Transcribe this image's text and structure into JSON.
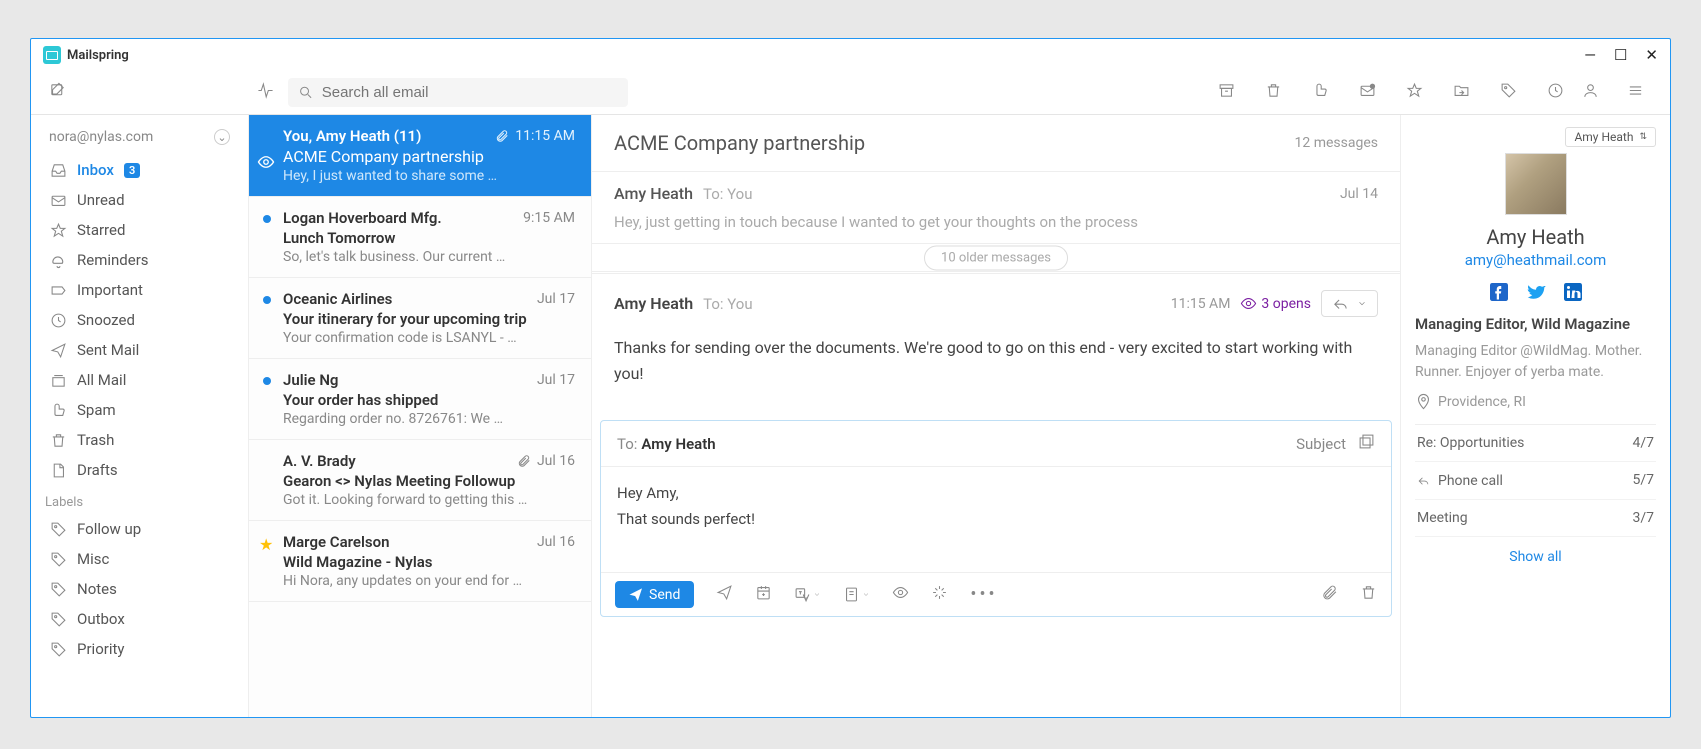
{
  "app": {
    "title": "Mailspring"
  },
  "toolbar": {
    "search_placeholder": "Search all email"
  },
  "account": {
    "email": "nora@nylas.com"
  },
  "sidebar": {
    "folders": [
      {
        "label": "Inbox",
        "badge": "3",
        "active": true,
        "icon": "inbox"
      },
      {
        "label": "Unread",
        "icon": "mail"
      },
      {
        "label": "Starred",
        "icon": "star"
      },
      {
        "label": "Reminders",
        "icon": "bell"
      },
      {
        "label": "Important",
        "icon": "tag"
      },
      {
        "label": "Snoozed",
        "icon": "clock"
      },
      {
        "label": "Sent Mail",
        "icon": "send"
      },
      {
        "label": "All Mail",
        "icon": "stack"
      },
      {
        "label": "Spam",
        "icon": "thumbdown"
      },
      {
        "label": "Trash",
        "icon": "trash"
      },
      {
        "label": "Drafts",
        "icon": "file"
      }
    ],
    "labels_header": "Labels",
    "labels": [
      {
        "label": "Follow up"
      },
      {
        "label": "Misc"
      },
      {
        "label": "Notes"
      },
      {
        "label": "Outbox"
      },
      {
        "label": "Priority"
      }
    ]
  },
  "messages": [
    {
      "from": "You, Amy Heath (11)",
      "time": "11:15 AM",
      "subject": "ACME Company partnership",
      "preview": "Hey, I just wanted to share some …",
      "selected": true,
      "attachment": true,
      "tracked": true
    },
    {
      "from": "Logan Hoverboard Mfg.",
      "time": "9:15 AM",
      "subject": "Lunch Tomorrow",
      "preview": "So, let's talk business. Our current …",
      "unread": true
    },
    {
      "from": "Oceanic Airlines",
      "time": "Jul 17",
      "subject": "Your itinerary for your upcoming trip",
      "preview": "Your confirmation code is LSANYL - …",
      "unread": true
    },
    {
      "from": "Julie Ng",
      "time": "Jul 17",
      "subject": "Your order has shipped",
      "preview": "Regarding order no. 8726761: We …",
      "unread": true
    },
    {
      "from": "A. V. Brady",
      "time": "Jul 16",
      "subject": "Gearon <> Nylas Meeting Followup",
      "preview": "Got it. Looking forward to getting this …",
      "attachment": true
    },
    {
      "from": "Marge Carelson",
      "time": "Jul 16",
      "subject": "Wild Magazine - Nylas",
      "preview": "Hi Nora, any updates on your end for …",
      "starred": true
    }
  ],
  "reader": {
    "subject": "ACME Company partnership",
    "count": "12 messages",
    "collapsed": {
      "from": "Amy Heath",
      "to": "To:  You",
      "date": "Jul 14",
      "preview": "Hey, just getting in touch because I wanted to get your thoughts on the process"
    },
    "older_label": "10 older messages",
    "open": {
      "from": "Amy Heath",
      "to": "To:  You",
      "time": "11:15 AM",
      "opens": "3 opens",
      "body": "Thanks for sending over the documents. We're good to go on this end - very excited to start working with you!"
    },
    "compose": {
      "to_label": "To:",
      "to": "Amy Heath",
      "subject_label": "Subject",
      "body_line1": "Hey Amy,",
      "body_line2": "That sounds perfect!",
      "send_label": "Send"
    }
  },
  "contact": {
    "picker": "Amy Heath",
    "name": "Amy Heath",
    "email": "amy@heathmail.com",
    "role": "Managing Editor, Wild Magazine",
    "bio": "Managing Editor @WildMag. Mother. Runner. Enjoyer of yerba mate.",
    "location": "Providence, RI",
    "related": [
      {
        "label": "Re: Opportunities",
        "date": "4/7",
        "icon": ""
      },
      {
        "label": "Phone call",
        "date": "5/7",
        "icon": "reply"
      },
      {
        "label": "Meeting",
        "date": "3/7",
        "icon": ""
      }
    ],
    "showall": "Show all"
  }
}
